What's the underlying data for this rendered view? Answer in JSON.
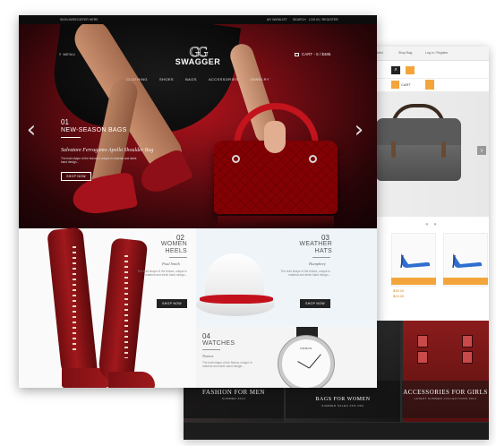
{
  "back_page": {
    "topbar_items": [
      "My Wishlist",
      "Shop Bag",
      "Log in / Register"
    ],
    "cart_label": "CART",
    "category_banners": [
      {
        "title": "FASHION FOR MEN",
        "subtitle": "SUMMER 2014"
      },
      {
        "title": "BAGS FOR WOMEN",
        "subtitle": "SUMMER SALES 15% OFF"
      },
      {
        "title": "ACCESSORIES FOR GIRLS",
        "subtitle": "LATEST SUMMER COLLECTIONS 2014"
      }
    ],
    "product_prices": [
      "$35.00",
      "$24.00"
    ]
  },
  "front_page": {
    "topbar": {
      "left": "SIGN IN/REGISTER HERE",
      "wishlist": "MY WISHLIST",
      "search": "SEARCH",
      "login": "LOG IN / REGISTER"
    },
    "header": {
      "menu_label": "MENU",
      "logo_mark": "GG",
      "logo": "SWAGGER",
      "cart": "CART - 5 / $485"
    },
    "nav": [
      "CLOTHING",
      "SHOES",
      "BAGS",
      "ACCESSORIES",
      "JEWELRY"
    ],
    "slide": {
      "number": "01",
      "title": "NEW-SEASON BAGS",
      "subtitle": "Salvatore Ferragamo Apollo Shoulder Bag",
      "description": "The bold shape of the fedora is unique in material and sleek band design...",
      "button": "SHOP NOW"
    },
    "blocks": {
      "heels": {
        "number": "02",
        "title_line1": "WOMEN",
        "title_line2": "HEELS",
        "signature": "Paul Smith",
        "description": "The bold shape of the fedora, unique in material and sleek band design..."
      },
      "hats": {
        "number": "03",
        "title_line1": "WEATHER",
        "title_line2": "HATS",
        "signature": "Humphrey",
        "description": "The bold shape of the fedora, unique in material and sleek band design...",
        "button": "SHOP NOW"
      },
      "watches": {
        "number": "04",
        "title": "WATCHES",
        "signature": "Nomos",
        "description": "The bold shape of the fedora, unique in material and sleek band design...",
        "brand_on_dial": "NOMOS"
      },
      "heels_button": "SHOP NOW"
    }
  },
  "colors": {
    "accent": "#f3a53b",
    "hero_red": "#b3131c",
    "dark": "#0c0c0c"
  }
}
